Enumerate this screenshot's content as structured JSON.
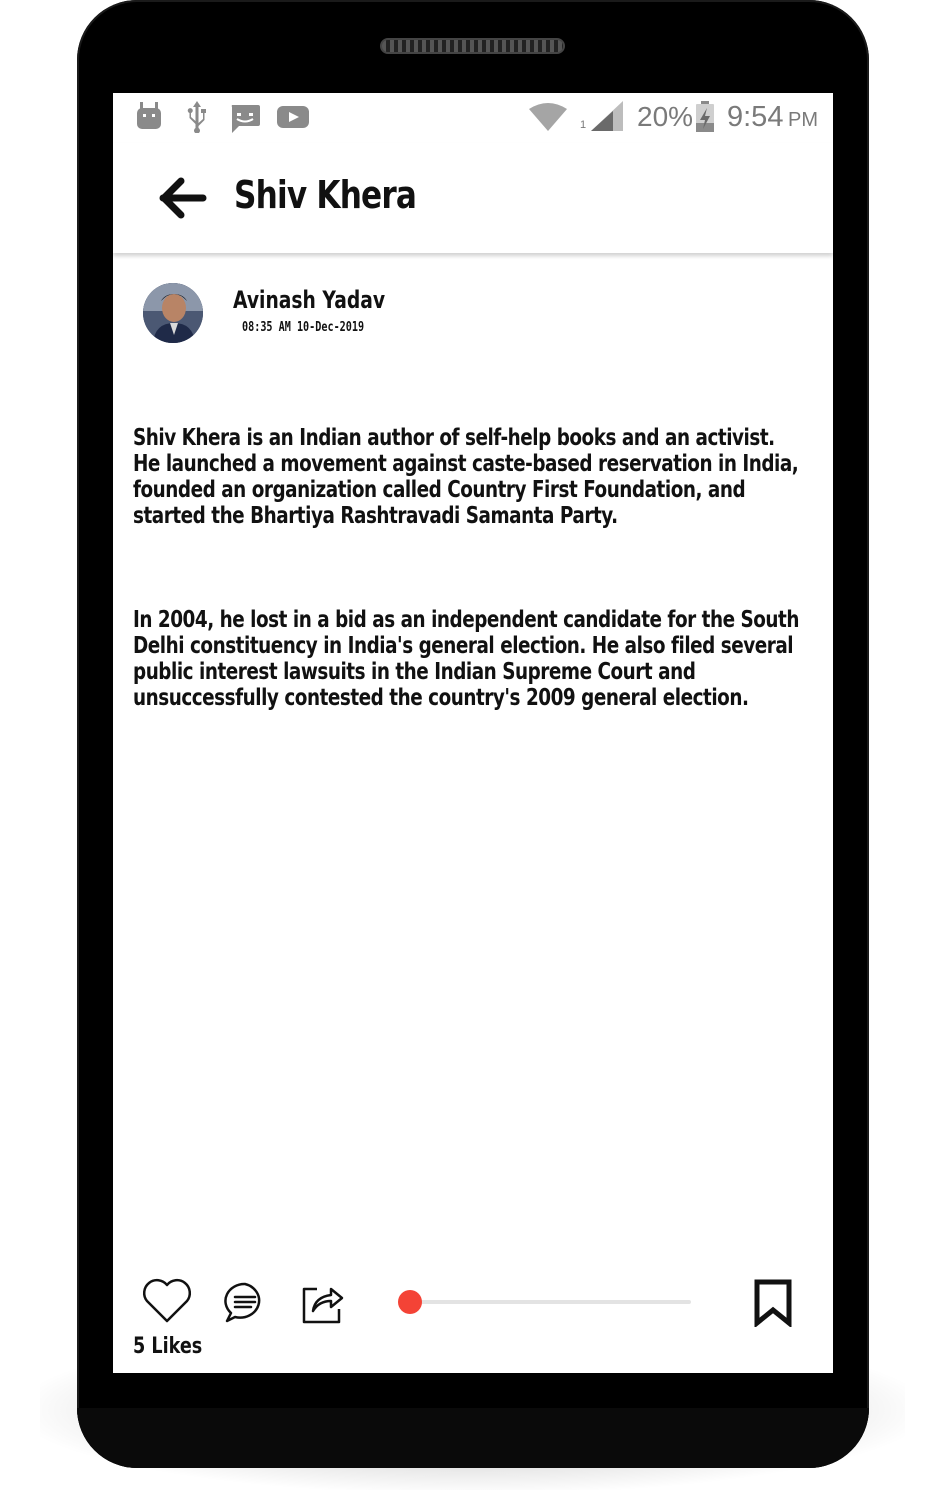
{
  "status_bar": {
    "battery": "20%",
    "time": "9:54",
    "ampm": "PM",
    "sim_slot": "1"
  },
  "appbar": {
    "title": "Shiv Khera"
  },
  "post": {
    "author": "Avinash Yadav",
    "timestamp": "08:35 AM 10-Dec-2019",
    "paragraphs": [
      "Shiv Khera is an  Indian  author of self-help books and an  activist. He launched a movement against caste-based reservation in India, founded an organization called Country First Foundation, and started the  Bhartiya Rashtravadi Samanta Party.",
      " In 2004, he lost in a bid as an independent candidate for the South Delhi constituency in India's general election. He also filed several public interest lawsuits in the Indian Supreme Court and unsuccessfully contested the country's 2009 general election."
    ]
  },
  "actions": {
    "likes_label": "5 Likes",
    "audio_progress": 0.0
  },
  "colors": {
    "accent": "#f44336",
    "status_icon": "#7a7a7a"
  },
  "icons": {
    "back": "arrow-left-icon",
    "like": "heart-icon",
    "comment": "comment-icon",
    "share": "share-icon",
    "bookmark": "bookmark-icon"
  }
}
